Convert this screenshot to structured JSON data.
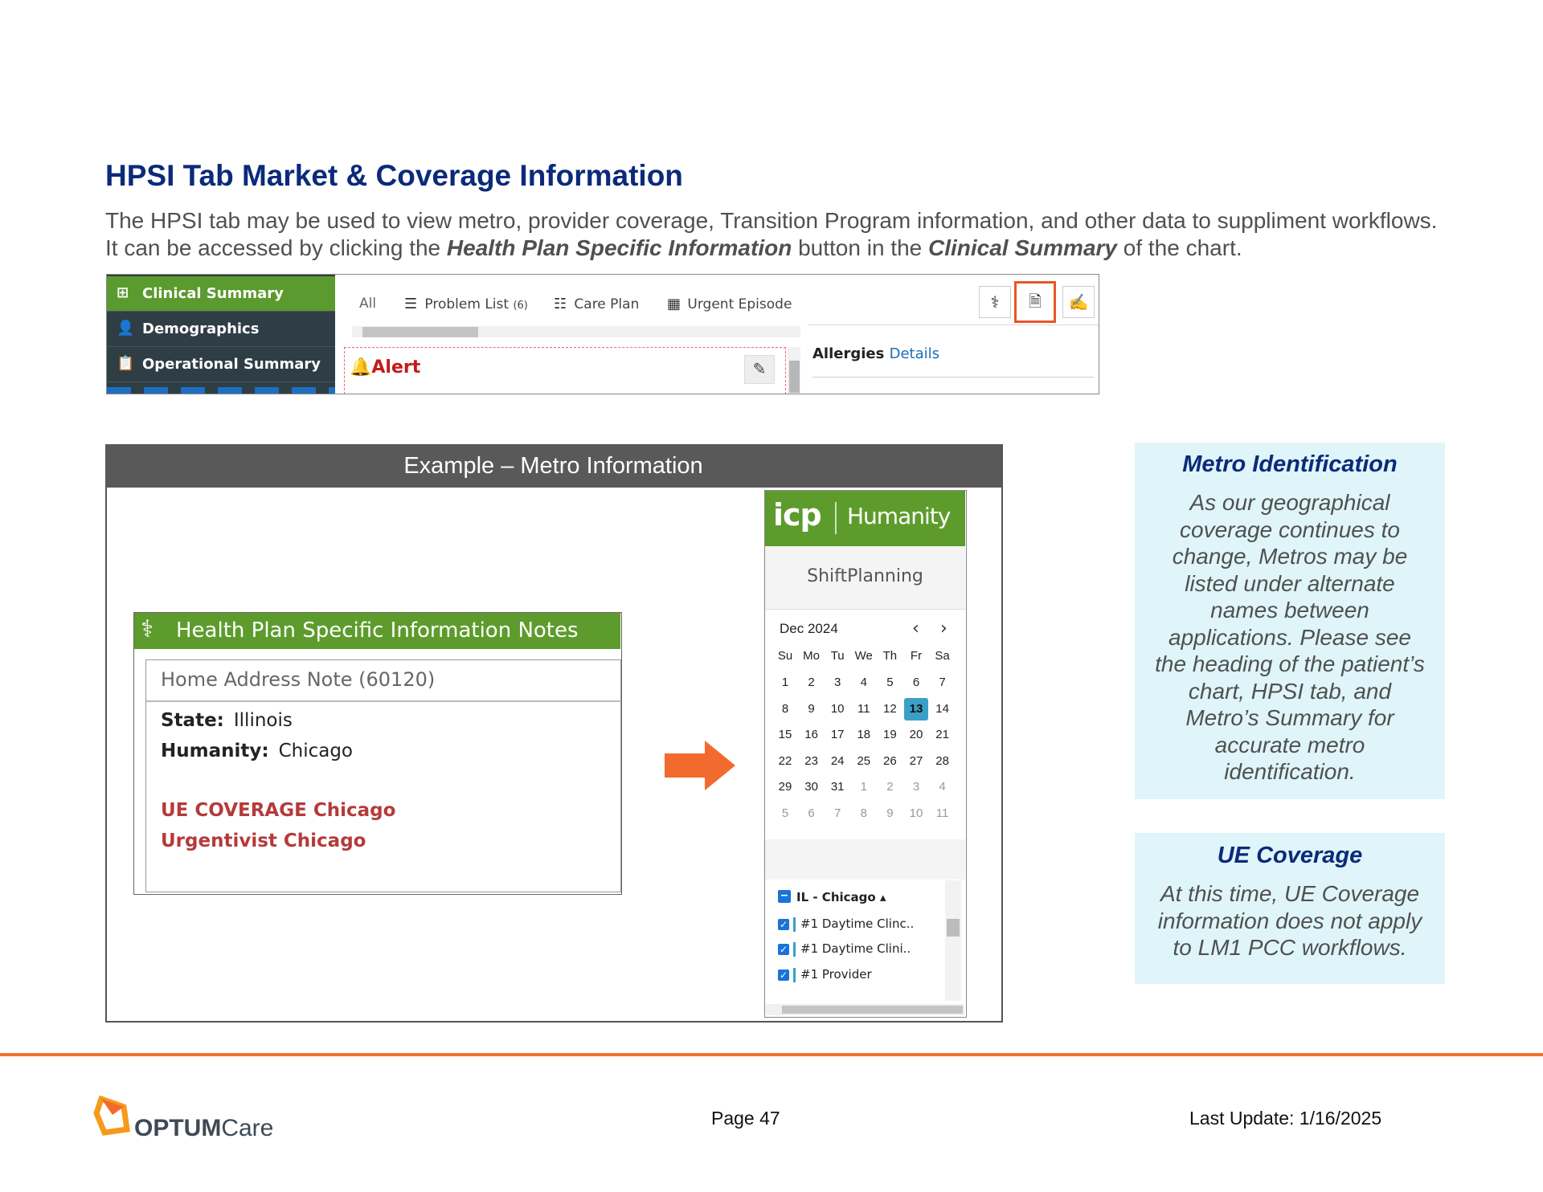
{
  "title": "HPSI Tab Market & Coverage Information",
  "intro": {
    "part1": "The HPSI tab may be used to view metro, provider coverage, Transition Program information, and other data to suppliment workflows. It can be accessed by clicking the ",
    "bold1": "Health Plan Specific Information",
    "part2": " button in the ",
    "bold2": "Clinical Summary",
    "part3": " of the chart."
  },
  "chart_nav": {
    "items": [
      {
        "label": "Clinical Summary",
        "icon": "plus-document-icon"
      },
      {
        "label": "Demographics",
        "icon": "person-list-icon"
      },
      {
        "label": "Operational Summary",
        "icon": "clipboard-icon"
      }
    ]
  },
  "chart_tabs": {
    "all": "All",
    "problem_list": "Problem List",
    "problem_count": "(6)",
    "care_plan": "Care Plan",
    "urgent_episode": "Urgent Episode"
  },
  "alert_label": "Alert",
  "allergies": {
    "label": "Allergies",
    "link": "Details"
  },
  "highlight_color": "#e8562a",
  "example": {
    "header": "Example – Metro Information"
  },
  "hpsi_card": {
    "title": "Health Plan Specific Information Notes",
    "note_title": "Home Address Note (60120)",
    "state_label": "State:",
    "state_value": "Illinois",
    "humanity_label": "Humanity:",
    "humanity_value": "Chicago",
    "coverage_line": "UE COVERAGE Chicago",
    "urgentivist_line": "Urgentivist Chicago"
  },
  "humanity": {
    "brand_left": "icp",
    "brand_right": "Humanity",
    "subtitle": "ShiftPlanning",
    "month": "Dec 2024",
    "weekdays": [
      "Su",
      "Mo",
      "Tu",
      "We",
      "Th",
      "Fr",
      "Sa"
    ],
    "weeks": [
      [
        "1",
        "2",
        "3",
        "4",
        "5",
        "6",
        "7"
      ],
      [
        "8",
        "9",
        "10",
        "11",
        "12",
        "13",
        "14"
      ],
      [
        "15",
        "16",
        "17",
        "18",
        "19",
        "20",
        "21"
      ],
      [
        "22",
        "23",
        "24",
        "25",
        "26",
        "27",
        "28"
      ],
      [
        "29",
        "30",
        "31",
        "1",
        "2",
        "3",
        "4"
      ],
      [
        "5",
        "6",
        "7",
        "8",
        "9",
        "10",
        "11"
      ]
    ],
    "today": "13",
    "location": "IL - Chicago",
    "schedules": [
      "#1 Daytime Clinc..",
      "#1 Daytime Clini..",
      "#1 Provider"
    ]
  },
  "side_boxes": [
    {
      "heading": "Metro Identification",
      "body": "As our geographical coverage continues to change, Metros may be listed under alternate names between applications. Please see the heading of the patient’s chart, HPSI tab, and Metro’s Summary for accurate metro identification."
    },
    {
      "heading": "UE Coverage",
      "body": "At this time, UE Coverage information does not apply to LM1 PCC workflows."
    }
  ],
  "footer": {
    "logo_main": "OPTUM",
    "logo_sub": "Care",
    "page": "Page 47",
    "last_update": "Last Update: 1/16/2025"
  }
}
